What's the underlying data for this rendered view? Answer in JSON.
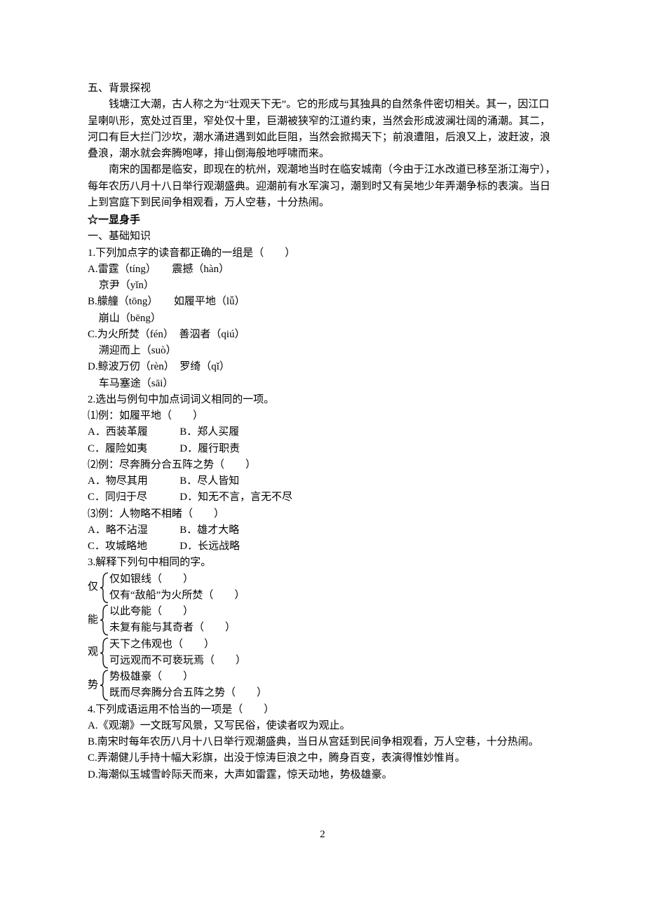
{
  "section5": {
    "heading": "五、背景探视",
    "para1": "钱塘江大潮，古人称之为“壮观天下无”。它的形成与其独具的自然条件密切相关。其一，因江口呈喇叭形，宽处过百里，窄处仅十里，巨潮被狭窄的江道约束，当然会形成波澜壮阔的涌潮。其二，河口有巨大拦门沙坎，潮水涌进遇到如此巨阻，当然会掀揭天下；前浪遭阻，后浪又上，波赶波，浪叠浪，潮水就会奔腾咆哮，排山倒海般地呼啸而来。",
    "para2": "南宋的国都是临安，即现在的杭州，观潮地当时在临安城南（今由于江水改道已移至浙江海宁），每年农历八月十八日举行观潮盛典。迎潮前有水军演习，潮到时又有吴地少年弄潮争标的表演。当日上到宫庭下到民间争相观看，万人空巷，十分热闹。"
  },
  "show": {
    "star_heading": "☆一显身手",
    "base_heading": "一、基础知识",
    "q1": {
      "stem": "1.下列加点字的读音都正确的一组是（　　）",
      "A1": "A.雷霆（tíng）　　震撼（hàn）",
      "A2": "京尹（yǐn）",
      "B1": "B.艨艟（tōng）　　如履平地（lǚ）",
      "B2": "崩山（bēng）",
      "C1": "C.为火所焚（fén）　善泅者（qiú）",
      "C2": "溯迎而上（suò）",
      "D1": "D.鲸波万仞（rèn）　罗绮（qǐ）",
      "D2": "车马塞途（sāi）"
    },
    "q2": {
      "stem": "2.选出与例句中加点词词义相同的一项。",
      "p1": {
        "ex": "⑴例：如履平地（　　）",
        "A": "A．西装革履",
        "B": "B．郑人买履",
        "C": "C．履险如夷",
        "D": "D．履行职责"
      },
      "p2": {
        "ex": "⑵例：尽奔腾分合五阵之势（　　）",
        "A": "A．物尽其用",
        "B": "B．尽人皆知",
        "C": "C．同归于尽",
        "D": "D．知无不言，言无不尽"
      },
      "p3": {
        "ex": "⑶例：人物略不相睹（　　）",
        "A": "A．略不沾湿",
        "B": "B．雄才大略",
        "C": "C．攻城略地",
        "D": "D．长远战略"
      }
    },
    "q3": {
      "stem": "3.解释下列句中相同的字。",
      "g1": {
        "prefix": "仅",
        "i1": "仅如银线（　　）",
        "i2": "仅有“敌船”为火所焚（　　）"
      },
      "g2": {
        "prefix": "能",
        "i1": "以此夸能（　　）",
        "i2": "未复有能与其奇者（　　）"
      },
      "g3": {
        "prefix": "观",
        "i1": "天下之伟观也（　　）",
        "i2": "可远观而不可亵玩焉（　　）"
      },
      "g4": {
        "prefix": "势",
        "i1": "势极雄豪（　　）",
        "i2": "既而尽奔腾分合五阵之势（　　）"
      }
    },
    "q4": {
      "stem": "4.下列成语运用不恰当的一项是（　　）",
      "A": "A.《观潮》一文既写风景，又写民俗，使读者叹为观止。",
      "B": "B.南宋时每年农历八月十八日举行观潮盛典，当日从宫廷到民间争相观看，万人空巷，十分热闹。",
      "C": "C.弄潮健儿手持十幅大彩旗，出没于惊涛巨浪之中，腾身百变，表演得惟妙惟肖。",
      "D": "D.海潮似玉城雪岭际天而来，大声如雷霆，惊天动地，势极雄豪。"
    }
  },
  "pagenum": "2"
}
